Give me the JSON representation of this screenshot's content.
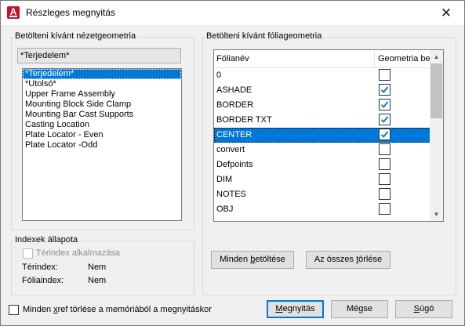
{
  "window": {
    "title": "Részleges megnyitás",
    "close_glyph": "✕"
  },
  "view_geometry": {
    "section_label": "Betölteni kívánt nézetgeometria",
    "combo_value": "*Terjedelem*",
    "items": [
      "*Terjedelem*",
      "*Utolsó*",
      "Upper Frame Assembly",
      "Mounting Block Side Clamp",
      "Mounting Bar Cast Supports",
      "Casting Location",
      "Plate Locator - Even",
      "Plate Locator -Odd"
    ],
    "selected_index": 0
  },
  "layer_geometry": {
    "section_label": "Betölteni kívánt fóliageometria",
    "col_name": "Fólianév",
    "col_geometry": "Geometria bet",
    "rows": [
      {
        "name": "0",
        "checked": false
      },
      {
        "name": "ASHADE",
        "checked": true
      },
      {
        "name": "BORDER",
        "checked": true
      },
      {
        "name": "BORDER TXT",
        "checked": true
      },
      {
        "name": "CENTER",
        "checked": true
      },
      {
        "name": "convert",
        "checked": false
      },
      {
        "name": "Defpoints",
        "checked": false
      },
      {
        "name": "DIM",
        "checked": false
      },
      {
        "name": "NOTES",
        "checked": false
      },
      {
        "name": "OBJ",
        "checked": false
      }
    ],
    "selected_index": 4,
    "load_all_prefix": "Minden ",
    "load_all_hotkey": "b",
    "load_all_suffix": "etöltése",
    "clear_all_prefix": "Az összes ",
    "clear_all_hotkey": "t",
    "clear_all_suffix": "örlése"
  },
  "index_status": {
    "section_label": "Indexek állapota",
    "spatial_checkbox_label": "Térindex alkalmazása",
    "spatial_label": "Térindex:",
    "spatial_value": "Nem",
    "layer_label": "Fóliaindex:",
    "layer_value": "Nem"
  },
  "footer": {
    "xref_prefix": "Minden ",
    "xref_hotkey": "x",
    "xref_suffix": "ref törlése a memóriából a megnyitáskor",
    "open_hotkey": "M",
    "open_suffix": "egnyitás",
    "cancel_label": "Mégse",
    "help_hotkey": "S",
    "help_suffix": "úgó"
  },
  "colors": {
    "accent": "#0078d7",
    "app_icon": "#c8102e"
  }
}
